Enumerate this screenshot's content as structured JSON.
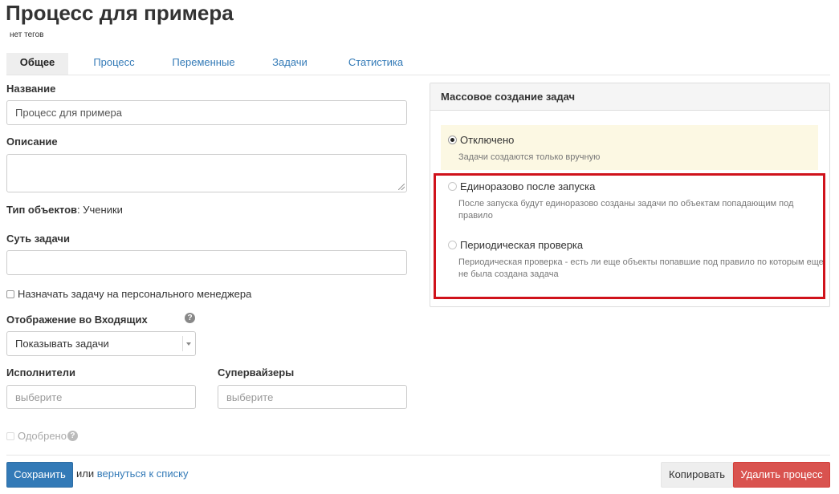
{
  "header": {
    "title": "Процесс для примера",
    "tags": "нет тегов"
  },
  "tabs": [
    {
      "label": "Общее",
      "active": true
    },
    {
      "label": "Процесс"
    },
    {
      "label": "Переменные"
    },
    {
      "label": "Задачи"
    },
    {
      "label": "Статистика"
    }
  ],
  "form": {
    "name_label": "Название",
    "name_value": "Процесс для примера",
    "description_label": "Описание",
    "description_value": "",
    "object_type_label": "Тип объектов",
    "object_type_value": ": Ученики",
    "task_essence_label": "Суть задачи",
    "task_essence_value": "",
    "assign_manager_label": "Назначать задачу на персонального менеджера",
    "inbox_display_label": "Отображение во Входящих",
    "inbox_display_value": "Показывать задачи",
    "executors_label": "Исполнители",
    "executors_placeholder": "выберите",
    "supervisors_label": "Супервайзеры",
    "supervisors_placeholder": "выберите",
    "approved_label": "Одобрено",
    "help_glyph": "?"
  },
  "mass_creation": {
    "heading": "Массовое создание задач",
    "options": [
      {
        "label": "Отключено",
        "desc": "Задачи создаются только вручную",
        "selected": true
      },
      {
        "label": "Единоразово после запуска",
        "desc_line1": "После запуска будут единоразово созданы задачи по объектам попадающим под",
        "desc_line2": "правило",
        "selected": false
      },
      {
        "label": "Периодическая проверка",
        "desc_line1": "Периодическая проверка - есть ли еще объекты попавшие под правило по которым еще",
        "desc_line2": "не была создана задача",
        "selected": false
      }
    ],
    "highlight_color": "#d0121b"
  },
  "footer": {
    "save_label": "Сохранить",
    "or_text": "или",
    "back_link": "вернуться к списку",
    "copy_label": "Копировать",
    "delete_label": "Удалить процесс"
  },
  "colors": {
    "primary": "#337ab7",
    "danger": "#d9534f",
    "selected_bg": "#fcf8e3"
  }
}
